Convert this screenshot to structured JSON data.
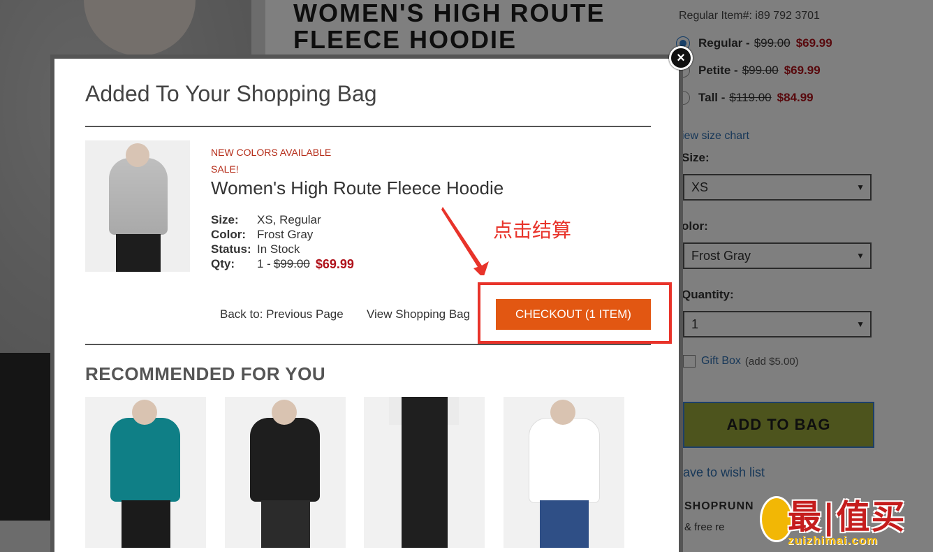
{
  "page": {
    "title_line1": "WOMEN'S HIGH ROUTE",
    "title_line2": "FLEECE HOODIE",
    "regular_item": "Regular Item#: i89 792 3701",
    "fits": [
      {
        "label": "Regular -",
        "old": "$99.00",
        "new": "$69.99",
        "selected": true
      },
      {
        "label": "Petite -",
        "old": "$99.00",
        "new": "$69.99",
        "selected": false
      },
      {
        "label": "Tall -",
        "old": "$119.00",
        "new": "$84.99",
        "selected": false
      }
    ],
    "size_chart": "iew size chart",
    "size_label": "Size:",
    "size_value": "XS",
    "color_label": "olor:",
    "color_value": "Frost Gray",
    "quantity_label": "Quantity:",
    "quantity_value": "1",
    "gift_box_link": "Gift Box",
    "gift_box_note": "(add $5.00)",
    "add_to_bag": "ADD TO BAG",
    "wishlist": "ave to wish list",
    "shoprunner": "SHOPRUNN",
    "shoprunner2": "& free re"
  },
  "modal": {
    "title": "Added To Your Shopping Bag",
    "close_glyph": "×",
    "tag_new": "NEW COLORS AVAILABLE",
    "tag_sale": "SALE!",
    "product_name": "Women's High Route Fleece Hoodie",
    "size_key": "Size:",
    "size_val": "XS, Regular",
    "color_key": "Color:",
    "color_val": "Frost Gray",
    "status_key": "Status:",
    "status_val": "In Stock",
    "qty_key": "Qty:",
    "qty_val": "1 -",
    "qty_old": "$99.00",
    "qty_price": "$69.99",
    "back_link": "Back to: Previous Page",
    "view_bag": "View Shopping Bag",
    "checkout": "CHECKOUT (1 ITEM)",
    "annotation": "点击结算",
    "recommended_title": "RECOMMENDED FOR YOU",
    "recommended": [
      {
        "color": "#0f7f86",
        "legs": "#1b1b1b"
      },
      {
        "color": "#1e1e1e",
        "legs": "#2b2b2b"
      },
      {
        "color": "#e9e9e9",
        "legs": "#1f1f1f"
      },
      {
        "color": "#ffffff",
        "legs": "#2f4f86"
      }
    ]
  },
  "watermark": {
    "text": "最|值买",
    "sub": "zuizhimai.com"
  },
  "colors": {
    "accent_orange": "#e25712",
    "price_red": "#b0121b",
    "annotation_red": "#e8332a",
    "link_blue": "#2f6fb0",
    "add_to_bag_green": "#9aa83a"
  }
}
